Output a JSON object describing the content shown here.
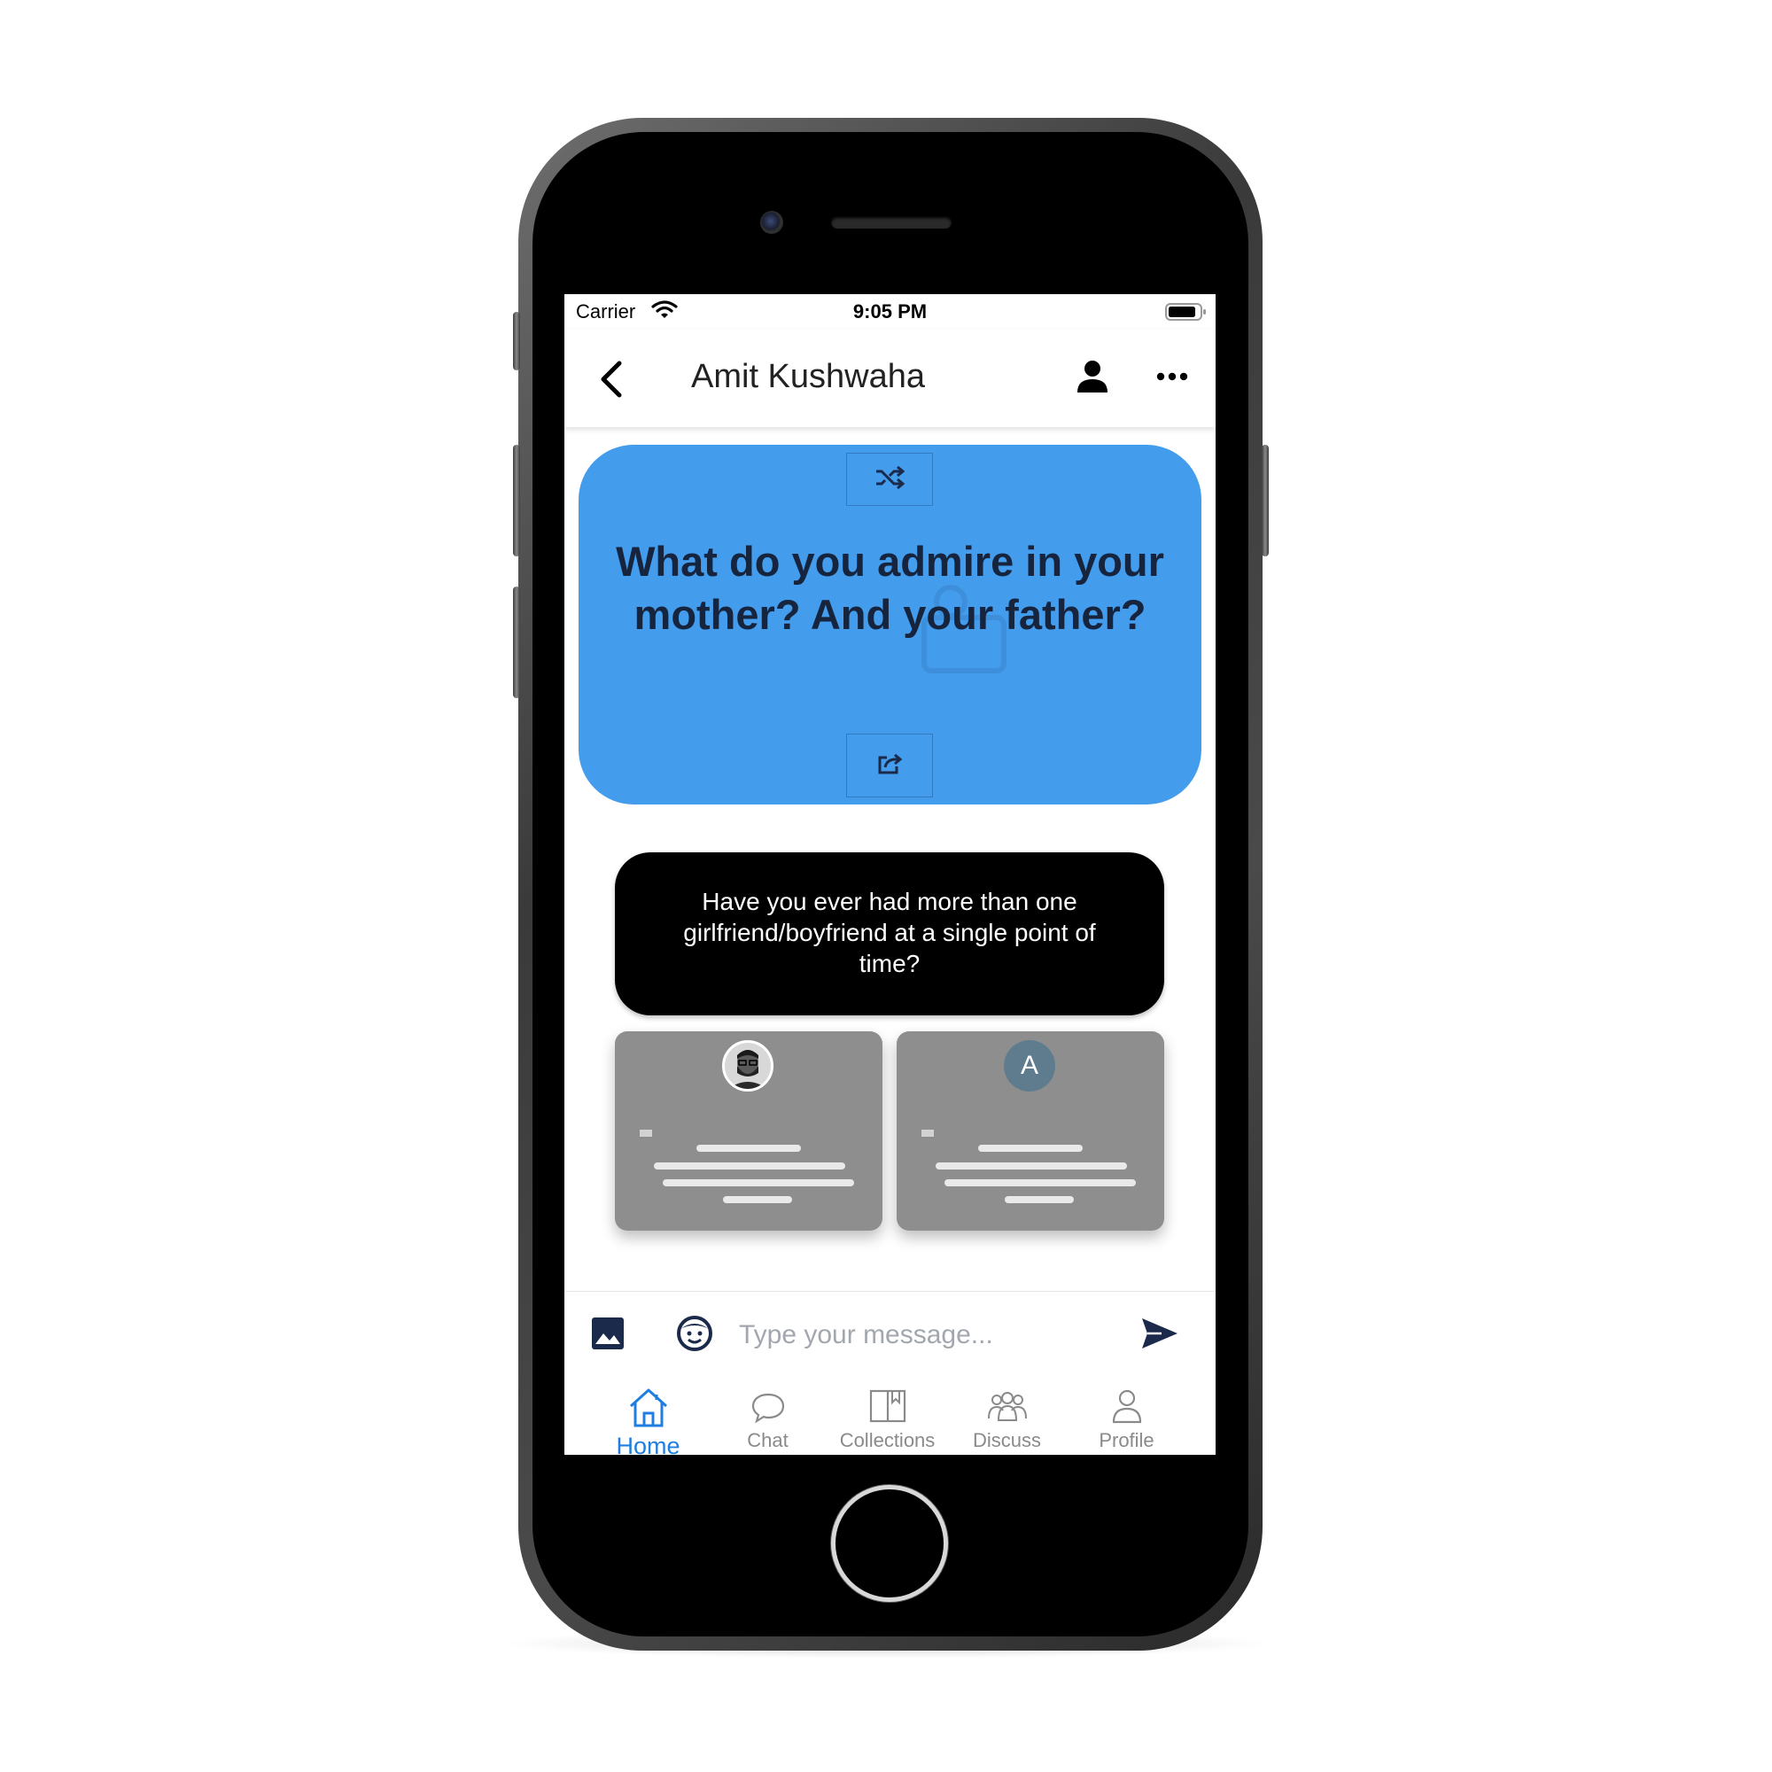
{
  "status_bar": {
    "carrier": "Carrier",
    "time": "9:05 PM"
  },
  "nav": {
    "title": "Amit Kushwaha"
  },
  "question_card": {
    "question": "What do you admire in your mother? And your father?",
    "color": "#439cec"
  },
  "prompt_card": {
    "text": "Have you ever had more than one girlfriend/boyfriend at a single point of time?"
  },
  "answer_cards": [
    {
      "avatar_type": "photo"
    },
    {
      "avatar_type": "letter",
      "avatar_letter": "A"
    }
  ],
  "composer": {
    "placeholder": "Type your message..."
  },
  "tabs": [
    {
      "label": "Home",
      "icon": "home-icon",
      "active": true
    },
    {
      "label": "Chat",
      "icon": "chat-bubble-icon",
      "active": false
    },
    {
      "label": "Collections",
      "icon": "book-icon",
      "active": false
    },
    {
      "label": "Discuss",
      "icon": "group-icon",
      "active": false
    },
    {
      "label": "Profile",
      "icon": "person-outline-icon",
      "active": false
    }
  ],
  "colors": {
    "accent": "#1f7ee0",
    "inactive": "#8a8a8a",
    "dark_icon": "#1b2a4a"
  }
}
